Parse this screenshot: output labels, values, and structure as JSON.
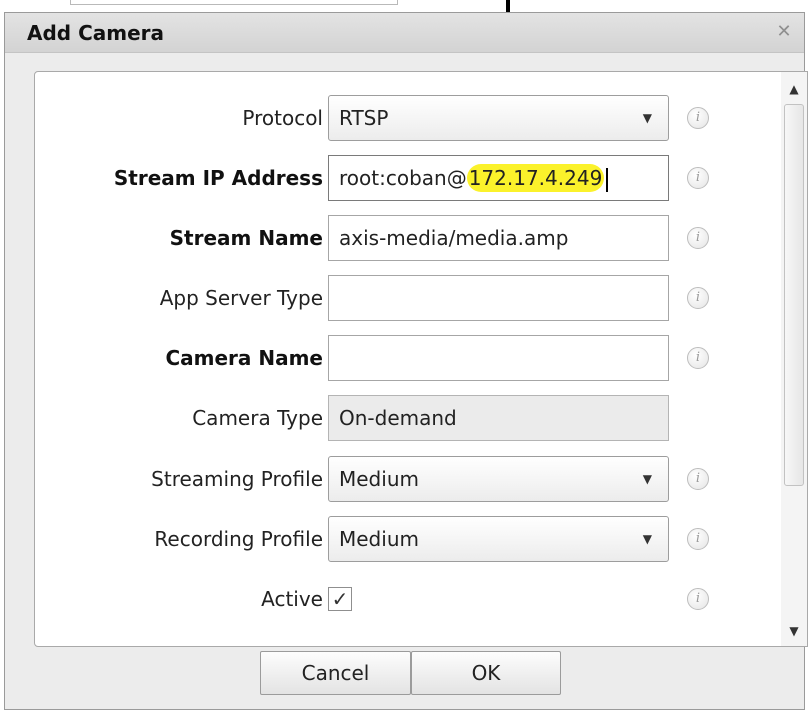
{
  "dialog": {
    "title": "Add Camera",
    "close_icon": "close-icon"
  },
  "form": {
    "protocol": {
      "label": "Protocol",
      "value": "RTSP",
      "bold": false
    },
    "stream_ip": {
      "label": "Stream IP Address",
      "value_prefix": "root:coban@",
      "value_highlight": "172.17.4.249",
      "bold": true
    },
    "stream_name": {
      "label": "Stream Name",
      "value": "axis-media/media.amp",
      "bold": true
    },
    "app_server_type": {
      "label": "App Server Type",
      "value": "",
      "bold": false
    },
    "camera_name": {
      "label": "Camera Name",
      "value": "",
      "bold": true
    },
    "camera_type": {
      "label": "Camera Type",
      "value": "On-demand",
      "bold": false
    },
    "streaming_profile": {
      "label": "Streaming Profile",
      "value": "Medium",
      "bold": false
    },
    "recording_profile": {
      "label": "Recording Profile",
      "value": "Medium",
      "bold": false
    },
    "active": {
      "label": "Active",
      "checked": true
    }
  },
  "icons": {
    "info": "info-icon",
    "dropdown": "chevron-down-icon",
    "scroll_up": "scroll-up-arrow-icon",
    "scroll_down": "scroll-down-arrow-icon"
  },
  "buttons": {
    "cancel_label": "Cancel",
    "ok_label": "OK"
  },
  "colors": {
    "highlight": "#fbf22b",
    "dialog_bg": "#ececec",
    "panel_bg": "#ffffff"
  }
}
